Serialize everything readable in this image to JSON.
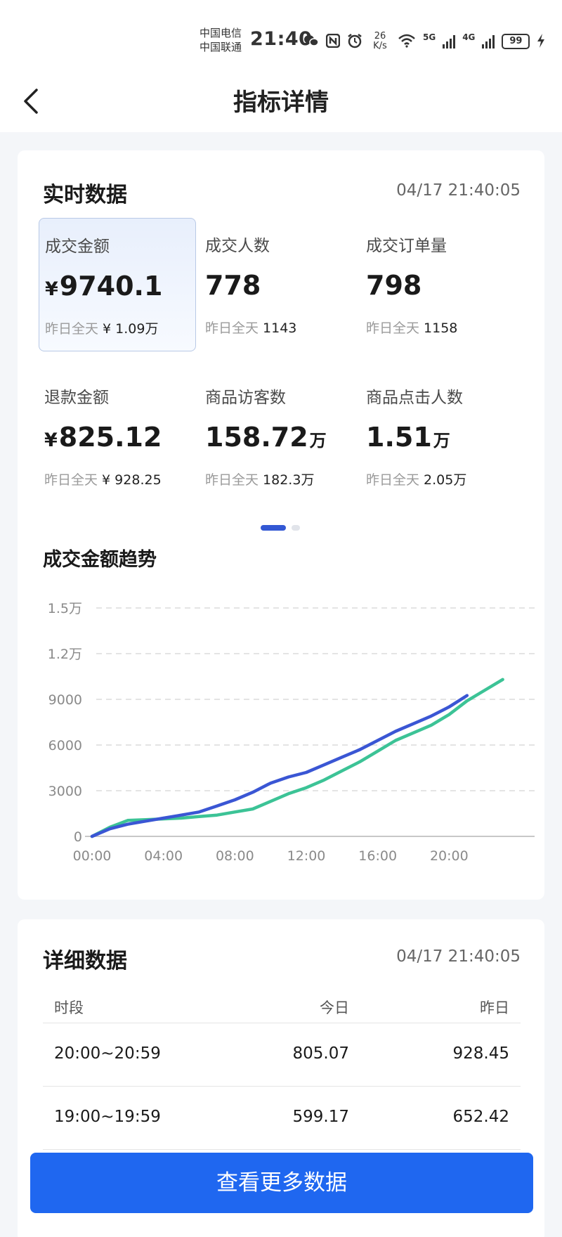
{
  "status_bar": {
    "carrier_1": "中国电信",
    "carrier_2": "中国联通",
    "time": "21:40",
    "speed_value": "26",
    "speed_unit": "K/s",
    "net_5g": "5G",
    "net_4g": "4G",
    "battery": "99",
    "icons": [
      "wechat-icon",
      "nfc-icon",
      "alarm-icon",
      "wifi-icon",
      "signal-icon",
      "charging-icon"
    ]
  },
  "header": {
    "title": "指标详情",
    "back_icon": "chevron-left-icon"
  },
  "realtime": {
    "title": "实时数据",
    "timestamp": "04/17 21:40:05",
    "metrics": [
      {
        "label": "成交金额",
        "currency": "¥",
        "value": "9740.1",
        "unit": "",
        "sub_label": "昨日全天",
        "sub_value": "¥ 1.09万",
        "selected": true
      },
      {
        "label": "成交人数",
        "currency": "",
        "value": "778",
        "unit": "",
        "sub_label": "昨日全天",
        "sub_value": "1143",
        "selected": false
      },
      {
        "label": "成交订单量",
        "currency": "",
        "value": "798",
        "unit": "",
        "sub_label": "昨日全天",
        "sub_value": "1158",
        "selected": false
      },
      {
        "label": "退款金额",
        "currency": "¥",
        "value": "825.12",
        "unit": "",
        "sub_label": "昨日全天",
        "sub_value": "¥ 928.25",
        "selected": false
      },
      {
        "label": "商品访客数",
        "currency": "",
        "value": "158.72",
        "unit": "万",
        "sub_label": "昨日全天",
        "sub_value": "182.3万",
        "selected": false
      },
      {
        "label": "商品点击人数",
        "currency": "",
        "value": "1.51",
        "unit": "万",
        "sub_label": "昨日全天",
        "sub_value": "2.05万",
        "selected": false
      }
    ],
    "pager": {
      "page": 1,
      "total": 2
    }
  },
  "trend": {
    "title": "成交金额趋势"
  },
  "chart_data": {
    "type": "line",
    "title": "成交金额趋势",
    "xlabel": "",
    "ylabel": "",
    "xlim": [
      0,
      24
    ],
    "ylim": [
      0,
      15000
    ],
    "x_ticks": [
      "00:00",
      "04:00",
      "08:00",
      "12:00",
      "16:00",
      "20:00"
    ],
    "y_ticks": [
      "0",
      "3000",
      "6000",
      "9000",
      "1.2万",
      "1.5万"
    ],
    "grid": true,
    "legend": "none",
    "colors": {
      "today": "#3a56d4",
      "yesterday": "#3cc396"
    },
    "series": [
      {
        "key": "today",
        "x": [
          0,
          1,
          2,
          3,
          4,
          5,
          6,
          7,
          8,
          9,
          10,
          11,
          12,
          13,
          14,
          15,
          16,
          17,
          18,
          19,
          20,
          21
        ],
        "values": [
          0,
          500,
          800,
          1000,
          1200,
          1400,
          1600,
          2000,
          2400,
          2900,
          3500,
          3900,
          4200,
          4700,
          5200,
          5700,
          6300,
          6900,
          7400,
          7900,
          8500,
          9250
        ]
      },
      {
        "key": "yesterday",
        "x": [
          0,
          1,
          2,
          3,
          4,
          5,
          6,
          7,
          8,
          9,
          10,
          11,
          12,
          13,
          14,
          15,
          16,
          17,
          18,
          19,
          20,
          21,
          22,
          23
        ],
        "values": [
          0,
          600,
          1050,
          1100,
          1150,
          1200,
          1300,
          1400,
          1600,
          1800,
          2300,
          2800,
          3200,
          3700,
          4300,
          4900,
          5600,
          6300,
          6800,
          7300,
          8000,
          8900,
          9600,
          10300
        ]
      }
    ]
  },
  "details": {
    "title": "详细数据",
    "timestamp": "04/17 21:40:05",
    "columns": [
      "时段",
      "今日",
      "昨日"
    ],
    "rows": [
      [
        "20:00~20:59",
        "805.07",
        "928.45"
      ],
      [
        "19:00~19:59",
        "599.17",
        "652.42"
      ]
    ]
  },
  "footer": {
    "more_button": "查看更多数据"
  }
}
